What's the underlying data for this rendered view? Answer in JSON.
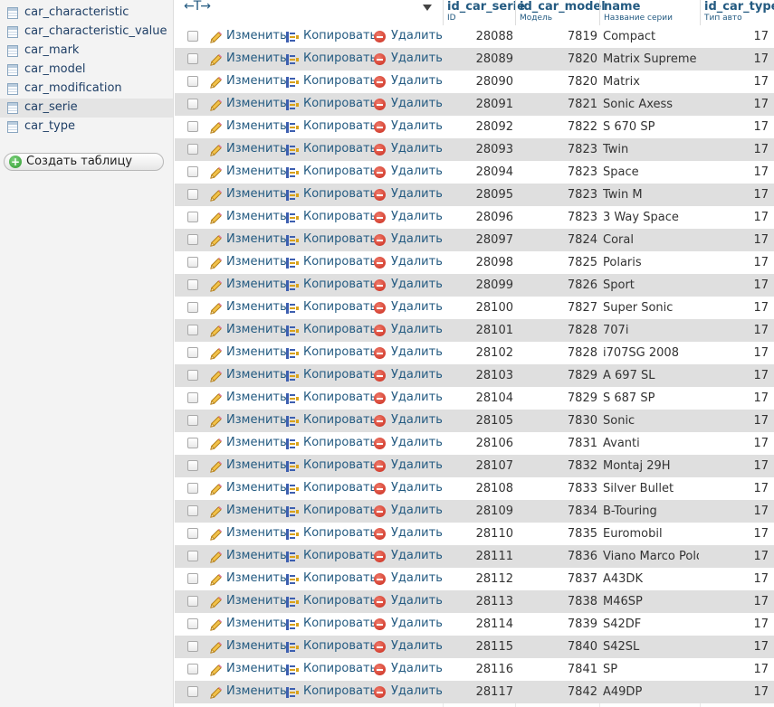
{
  "sidebar": {
    "tables": [
      {
        "label": "car_characteristic",
        "selected": false
      },
      {
        "label": "car_characteristic_value",
        "selected": false
      },
      {
        "label": "car_mark",
        "selected": false
      },
      {
        "label": "car_model",
        "selected": false
      },
      {
        "label": "car_modification",
        "selected": false
      },
      {
        "label": "car_serie",
        "selected": true
      },
      {
        "label": "car_type",
        "selected": false
      }
    ],
    "create_table_label": "Создать таблицу"
  },
  "header": {
    "arrows": "←T→",
    "columns": [
      {
        "name": "id_car_serie",
        "comment": "ID"
      },
      {
        "name": "id_car_model",
        "comment": "Модель"
      },
      {
        "name": "name",
        "comment": "Название серии"
      },
      {
        "name": "id_car_type",
        "comment": "Тип авто"
      }
    ]
  },
  "actions": {
    "edit": "Изменить",
    "copy": "Копировать",
    "delete": "Удалить"
  },
  "rows": [
    {
      "id": "28088",
      "model": "7819",
      "name": "Compact",
      "type": "17"
    },
    {
      "id": "28089",
      "model": "7820",
      "name": "Matrix Supreme",
      "type": "17"
    },
    {
      "id": "28090",
      "model": "7820",
      "name": "Matrix",
      "type": "17"
    },
    {
      "id": "28091",
      "model": "7821",
      "name": "Sonic Axess",
      "type": "17"
    },
    {
      "id": "28092",
      "model": "7822",
      "name": "S 670 SP",
      "type": "17"
    },
    {
      "id": "28093",
      "model": "7823",
      "name": "Twin",
      "type": "17"
    },
    {
      "id": "28094",
      "model": "7823",
      "name": "Space",
      "type": "17"
    },
    {
      "id": "28095",
      "model": "7823",
      "name": "Twin M",
      "type": "17"
    },
    {
      "id": "28096",
      "model": "7823",
      "name": "3 Way Space",
      "type": "17"
    },
    {
      "id": "28097",
      "model": "7824",
      "name": "Coral",
      "type": "17"
    },
    {
      "id": "28098",
      "model": "7825",
      "name": "Polaris",
      "type": "17"
    },
    {
      "id": "28099",
      "model": "7826",
      "name": "Sport",
      "type": "17"
    },
    {
      "id": "28100",
      "model": "7827",
      "name": "Super Sonic",
      "type": "17"
    },
    {
      "id": "28101",
      "model": "7828",
      "name": "707i",
      "type": "17"
    },
    {
      "id": "28102",
      "model": "7828",
      "name": "i707SG 2008",
      "type": "17"
    },
    {
      "id": "28103",
      "model": "7829",
      "name": "A 697 SL",
      "type": "17"
    },
    {
      "id": "28104",
      "model": "7829",
      "name": "S 687 SP",
      "type": "17"
    },
    {
      "id": "28105",
      "model": "7830",
      "name": "Sonic",
      "type": "17"
    },
    {
      "id": "28106",
      "model": "7831",
      "name": "Avanti",
      "type": "17"
    },
    {
      "id": "28107",
      "model": "7832",
      "name": "Montaj 29H",
      "type": "17"
    },
    {
      "id": "28108",
      "model": "7833",
      "name": "Silver Bullet",
      "type": "17"
    },
    {
      "id": "28109",
      "model": "7834",
      "name": "B-Touring",
      "type": "17"
    },
    {
      "id": "28110",
      "model": "7835",
      "name": "Euromobil",
      "type": "17"
    },
    {
      "id": "28111",
      "model": "7836",
      "name": "Viano Marco Polo",
      "type": "17"
    },
    {
      "id": "28112",
      "model": "7837",
      "name": "A43DK",
      "type": "17"
    },
    {
      "id": "28113",
      "model": "7838",
      "name": "M46SP",
      "type": "17"
    },
    {
      "id": "28114",
      "model": "7839",
      "name": "S42DF",
      "type": "17"
    },
    {
      "id": "28115",
      "model": "7840",
      "name": "S42SL",
      "type": "17"
    },
    {
      "id": "28116",
      "model": "7841",
      "name": "SP",
      "type": "17"
    },
    {
      "id": "28117",
      "model": "7842",
      "name": "A49DP",
      "type": "17"
    }
  ]
}
